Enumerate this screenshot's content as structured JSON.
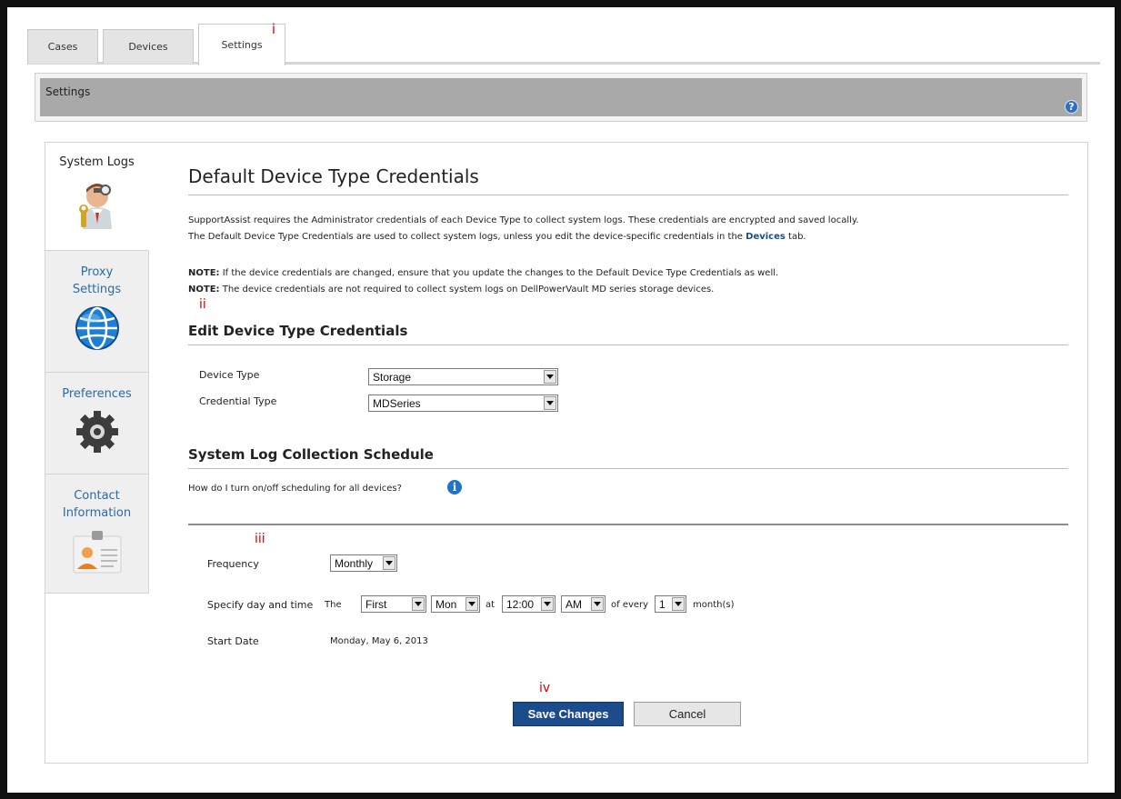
{
  "tabs": [
    {
      "label": "Cases"
    },
    {
      "label": "Devices"
    },
    {
      "label": "Settings",
      "annotation": "i"
    }
  ],
  "header": {
    "title": "Settings",
    "help_icon": "question-icon",
    "help_glyph": "?"
  },
  "sidebar": {
    "items": [
      {
        "label": "System Logs",
        "icon": "technician-icon"
      },
      {
        "label_line1": "Proxy",
        "label_line2": "Settings",
        "icon": "globe-icon"
      },
      {
        "label": "Preferences",
        "icon": "gear-icon"
      },
      {
        "label_line1": "Contact",
        "label_line2": "Information",
        "icon": "contact-card-icon"
      }
    ]
  },
  "main": {
    "title": "Default Device Type Credentials",
    "intro_line1": "SupportAssist requires the Administrator credentials of each Device Type to collect system logs. These credentials are encrypted and saved locally.",
    "intro_line2_before": "The Default Device Type Credentials are used to collect system logs, unless you edit the device-specific credentials in the ",
    "intro_line2_link": "Devices",
    "intro_line2_after": " tab.",
    "note_label": "NOTE:",
    "note1": " If the device credentials are changed, ensure that you update the changes to the Default Device Type Credentials as well.",
    "note2": " The device credentials are not required to collect system logs on DellPowerVault MD series storage devices.",
    "annotation_ii": "ii",
    "edit_section": {
      "title": "Edit Device Type Credentials",
      "device_type_label": "Device Type",
      "device_type_value": "Storage",
      "credential_type_label": "Credential Type",
      "credential_type_value": "MDSeries"
    },
    "schedule_section": {
      "title": "System Log Collection Schedule",
      "help_text": "How do I turn on/off scheduling for all devices?",
      "help_glyph": "i",
      "annotation_iii": "iii",
      "frequency_label": "Frequency",
      "frequency_value": "Monthly",
      "day_time_label": "Specify day and time",
      "the_text": "The",
      "week_value": "First",
      "day_value": "Mon",
      "at_text": "at",
      "time_value": "12:00",
      "ampm_value": "AM",
      "of_every_text": "of every",
      "interval_value": "1",
      "months_text": "month(s)",
      "start_date_label": "Start Date",
      "start_date_value": "Monday, May 6, 2013"
    },
    "annotation_iv": "iv",
    "save_label": "Save Changes",
    "cancel_label": "Cancel"
  }
}
